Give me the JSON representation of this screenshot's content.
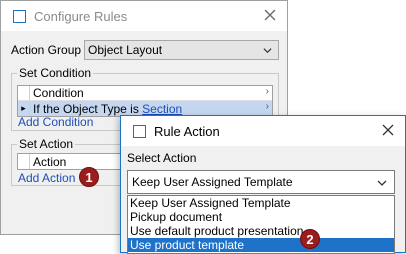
{
  "configure_rules": {
    "title": "Configure Rules",
    "action_group_label": "Action Group",
    "action_group_value": "Object Layout",
    "set_condition": {
      "legend": "Set Condition",
      "header": "Condition",
      "row_prefix": "If the Object Type is ",
      "row_link": "Section",
      "add_label": "Add Condition"
    },
    "set_action": {
      "legend": "Set Action",
      "header": "Action",
      "add_label": "Add Action"
    },
    "badge": "1"
  },
  "rule_action": {
    "title": "Rule Action",
    "select_label": "Select Action",
    "selected_value": "Keep User Assigned Template",
    "options": [
      "Keep User Assigned Template",
      "Pickup document",
      "Use default product presentation",
      "Use product template"
    ],
    "highlighted_index": 3,
    "badge": "2"
  },
  "colors": {
    "accent": "#1e73c8",
    "badge": "#9b1c1c",
    "link": "#1b4fbf",
    "selected_row": "#c5d7f0"
  },
  "icons": [
    "window-icon",
    "close-icon",
    "chevron-down-icon",
    "chevron-right-icon"
  ]
}
